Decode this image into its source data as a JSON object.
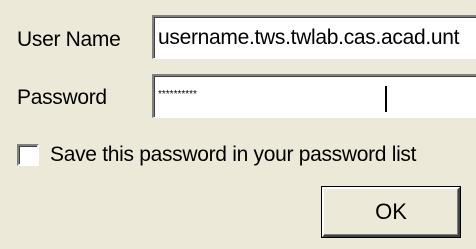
{
  "form": {
    "username_label": "User Name",
    "username_value": "username.tws.twlab.cas.acad.unt",
    "password_label": "Password",
    "password_masked": "**********",
    "save_password_label": "Save this password in your password list",
    "save_password_checked": false,
    "ok_label": "OK"
  }
}
